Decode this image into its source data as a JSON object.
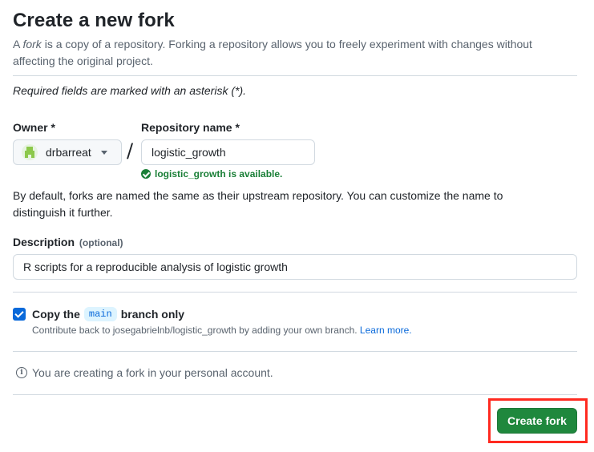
{
  "header": {
    "title": "Create a new fork",
    "intro_pre": "A ",
    "intro_em": "fork",
    "intro_post": " is a copy of a repository. Forking a repository allows you to freely experiment with changes without affecting the original project."
  },
  "required_note": "Required fields are marked with an asterisk (*).",
  "owner": {
    "label": "Owner *",
    "value": "drbarreat"
  },
  "repo": {
    "label": "Repository name *",
    "value": "logistic_growth",
    "availability": "logistic_growth is available."
  },
  "separator": "/",
  "help_text": "By default, forks are named the same as their upstream repository. You can customize the name to distinguish it further.",
  "description": {
    "label": "Description",
    "optional": "(optional)",
    "value": "R scripts for a reproducible analysis of logistic growth"
  },
  "copy_branch": {
    "checked": true,
    "label_pre": "Copy the",
    "branch": "main",
    "label_post": "branch only",
    "sub_text": "Contribute back to josegabrielnb/logistic_growth by adding your own branch.",
    "learn_more": "Learn more."
  },
  "info": {
    "icon": "info-icon",
    "text": "You are creating a fork in your personal account."
  },
  "submit": {
    "label": "Create fork"
  },
  "colors": {
    "primary_button": "#1f883d",
    "success_text": "#1a7f37",
    "link": "#0969da",
    "highlight_outline": "#ff2a20"
  }
}
